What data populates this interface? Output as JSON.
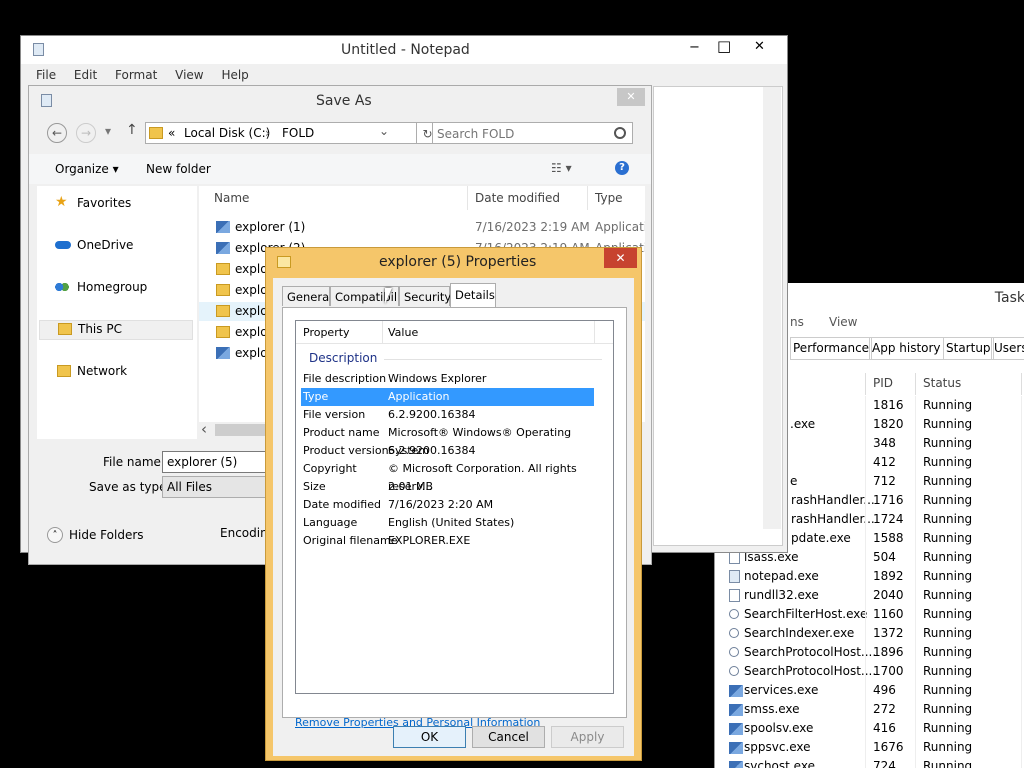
{
  "notepad": {
    "title": "Untitled - Notepad",
    "menu": [
      "File",
      "Edit",
      "Format",
      "View",
      "Help"
    ],
    "controls": {
      "minimize": "−",
      "maximize": "□",
      "close": "✕"
    }
  },
  "saveas": {
    "title": "Save As",
    "close": "✕",
    "nav": {
      "back": "←",
      "forward": "→",
      "recent": "▾",
      "up": "↑"
    },
    "address": {
      "prefix": "«",
      "crumb1": "Local Disk (C:)",
      "sep": "›",
      "crumb2": "FOLD",
      "dropdown": "⌄",
      "refresh": "↻"
    },
    "search_placeholder": "Search FOLD",
    "toolbar": {
      "organize": "Organize ▾",
      "new_folder": "New folder",
      "views": "☷ ▾",
      "help": "?"
    },
    "nav_pane": [
      "Favorites",
      "OneDrive",
      "Homegroup",
      "This PC",
      "Network"
    ],
    "columns": {
      "name": "Name",
      "date": "Date modified",
      "type": "Type",
      "sort_arrow": "˄"
    },
    "files": [
      {
        "name": "explorer (1)",
        "date": "7/16/2023 2:19 AM",
        "type": "Applicatio"
      },
      {
        "name": "explorer (2)",
        "date": "7/16/2023 2:19 AM",
        "type": "Applicatio"
      },
      {
        "name": "explor"
      },
      {
        "name": "explor"
      },
      {
        "name": "explor"
      },
      {
        "name": "explor"
      },
      {
        "name": "explor"
      }
    ],
    "scroll_left": "‹",
    "filename_label": "File name:",
    "filename_value": "explorer (5)",
    "savetype_label": "Save as type:",
    "savetype_value": "All Files",
    "hide_folders": "Hide Folders",
    "hide_icon": "˄",
    "encoding_label": "Encoding"
  },
  "props": {
    "title": "explorer (5) Properties",
    "close": "✕",
    "tabs": [
      "General",
      "Compatibili",
      "Security",
      "Details"
    ],
    "header": {
      "property": "Property",
      "value": "Value"
    },
    "section": "Description",
    "rows": [
      {
        "property": "File description",
        "value": "Windows Explorer"
      },
      {
        "property": "Type",
        "value": "Application"
      },
      {
        "property": "File version",
        "value": "6.2.9200.16384"
      },
      {
        "property": "Product name",
        "value": "Microsoft® Windows® Operating System"
      },
      {
        "property": "Product version",
        "value": "6.2.9200.16384"
      },
      {
        "property": "Copyright",
        "value": "© Microsoft Corporation. All rights reserv..."
      },
      {
        "property": "Size",
        "value": "2.01 MB"
      },
      {
        "property": "Date modified",
        "value": "7/16/2023 2:20 AM"
      },
      {
        "property": "Language",
        "value": "English (United States)"
      },
      {
        "property": "Original filename",
        "value": "EXPLORER.EXE"
      }
    ],
    "remove_link": "Remove Properties and Personal Information",
    "ok": "OK",
    "cancel": "Cancel",
    "apply": "Apply"
  },
  "taskmgr": {
    "title": "Task",
    "menu": [
      "ns",
      "View"
    ],
    "tabs": [
      "Performance",
      "App history",
      "Startup",
      "Users"
    ],
    "columns": {
      "pid": "PID",
      "status": "Status"
    },
    "rows": [
      {
        "name": "",
        "pid": "1816",
        "status": "Running"
      },
      {
        "name": ".exe",
        "pid": "1820",
        "status": "Running"
      },
      {
        "name": "",
        "pid": "348",
        "status": "Running"
      },
      {
        "name": "",
        "pid": "412",
        "status": "Running"
      },
      {
        "name": "e",
        "pid": "712",
        "status": "Running"
      },
      {
        "name": "rashHandler...",
        "pid": "1716",
        "status": "Running"
      },
      {
        "name": "rashHandler...",
        "pid": "1724",
        "status": "Running"
      },
      {
        "name": "pdate.exe",
        "pid": "1588",
        "status": "Running"
      },
      {
        "name": "lsass.exe",
        "pid": "504",
        "status": "Running"
      },
      {
        "name": "notepad.exe",
        "pid": "1892",
        "status": "Running"
      },
      {
        "name": "rundll32.exe",
        "pid": "2040",
        "status": "Running"
      },
      {
        "name": "SearchFilterHost.exe",
        "pid": "1160",
        "status": "Running"
      },
      {
        "name": "SearchIndexer.exe",
        "pid": "1372",
        "status": "Running"
      },
      {
        "name": "SearchProtocolHost....",
        "pid": "1896",
        "status": "Running"
      },
      {
        "name": "SearchProtocolHost....",
        "pid": "1700",
        "status": "Running"
      },
      {
        "name": "services.exe",
        "pid": "496",
        "status": "Running"
      },
      {
        "name": "smss.exe",
        "pid": "272",
        "status": "Running"
      },
      {
        "name": "spoolsv.exe",
        "pid": "416",
        "status": "Running"
      },
      {
        "name": "sppsvc.exe",
        "pid": "1676",
        "status": "Running"
      },
      {
        "name": "svchost.exe",
        "pid": "724",
        "status": "Running"
      }
    ]
  }
}
